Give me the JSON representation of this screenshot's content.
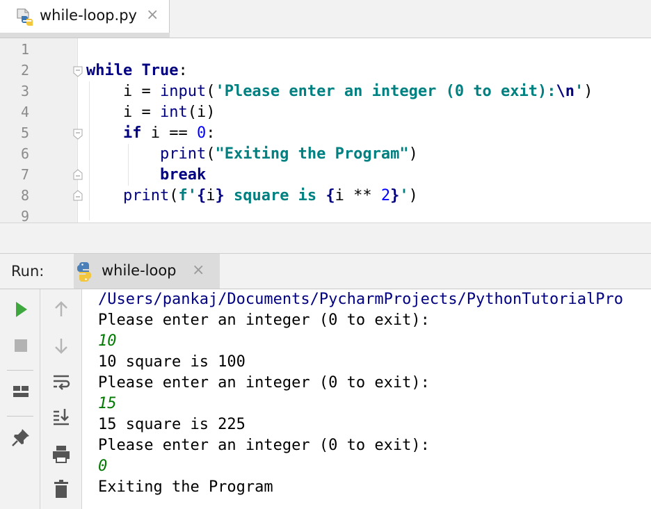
{
  "editor_tab": {
    "filename": "while-loop.py",
    "close_glyph": "×",
    "icon": "python-file-icon"
  },
  "editor": {
    "line_numbers": [
      "1",
      "2",
      "3",
      "4",
      "5",
      "6",
      "7",
      "8",
      "9"
    ],
    "code": {
      "l2_kw_while": "while",
      "l2_kw_true": "True",
      "l2_colon": ":",
      "l3_pre": "    i = ",
      "l3_fn": "input",
      "l3_open": "(",
      "l3_str": "'Please enter an integer (0 to exit):",
      "l3_esc": "\\n",
      "l3_str_end": "'",
      "l3_close": ")",
      "l4_pre": "    i = ",
      "l4_fn": "int",
      "l4_rest": "(i)",
      "l5_pre": "    ",
      "l5_kw": "if",
      "l5_mid": " i == ",
      "l5_num": "0",
      "l5_colon": ":",
      "l6_pre": "        ",
      "l6_fn": "print",
      "l6_open": "(",
      "l6_str": "\"Exiting the Program\"",
      "l6_close": ")",
      "l7_pre": "        ",
      "l7_kw": "break",
      "l8_pre": "    ",
      "l8_fn": "print",
      "l8_open": "(",
      "l8_fstr_start": "f'",
      "l8_brace1": "{",
      "l8_var1": "i",
      "l8_brace2": "}",
      "l8_mid": " square is ",
      "l8_brace3": "{",
      "l8_expr": "i ** ",
      "l8_num": "2",
      "l8_brace4": "}",
      "l8_fstr_end": "'",
      "l8_close": ")"
    }
  },
  "run_panel": {
    "label": "Run:",
    "tab_label": "while-loop",
    "tab_close": "×",
    "toolbar_left": [
      "run-icon",
      "stop-icon",
      "layout-icon",
      "pin-icon"
    ],
    "toolbar_right": [
      "arrow-up-icon",
      "arrow-down-icon",
      "soft-wrap-icon",
      "scroll-to-end-icon",
      "print-icon",
      "trash-icon"
    ],
    "console": {
      "path": "/Users/pankaj/Documents/PycharmProjects/PythonTutorialPro",
      "lines": [
        {
          "text": "Please enter an integer (0 to exit):",
          "kind": "output"
        },
        {
          "text": "10",
          "kind": "input"
        },
        {
          "text": "10 square is 100",
          "kind": "output"
        },
        {
          "text": "Please enter an integer (0 to exit):",
          "kind": "output"
        },
        {
          "text": "15",
          "kind": "input"
        },
        {
          "text": "15 square is 225",
          "kind": "output"
        },
        {
          "text": "Please enter an integer (0 to exit):",
          "kind": "output"
        },
        {
          "text": "0",
          "kind": "input"
        },
        {
          "text": "Exiting the Program",
          "kind": "output"
        }
      ]
    }
  },
  "colors": {
    "keyword": "#000080",
    "string": "#008080",
    "number": "#0000ff",
    "console_input": "#007a00",
    "run_green": "#3ea83e"
  }
}
